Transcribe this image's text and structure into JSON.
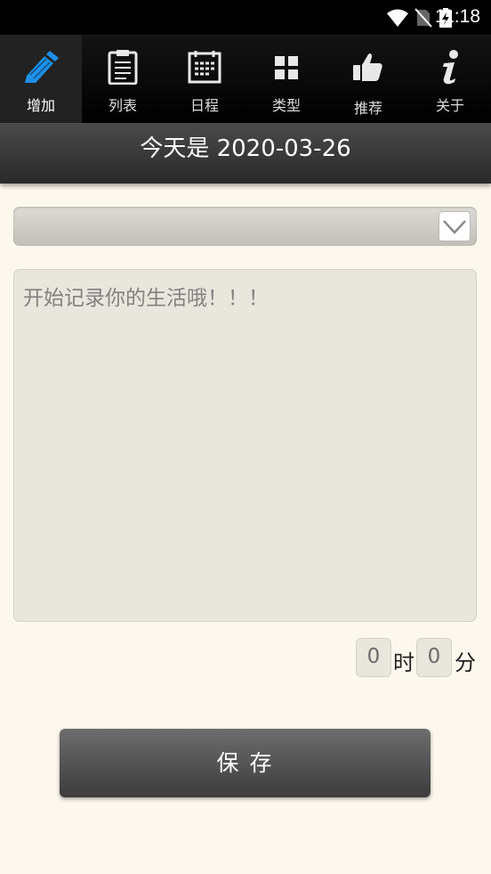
{
  "status_bar": {
    "time": "11:18"
  },
  "tabs": [
    {
      "label": "增加",
      "icon": "pencil-icon",
      "active": true
    },
    {
      "label": "列表",
      "icon": "clipboard-icon",
      "active": false
    },
    {
      "label": "日程",
      "icon": "calendar-icon",
      "active": false
    },
    {
      "label": "类型",
      "icon": "grid-icon",
      "active": false
    },
    {
      "label": "推荐",
      "icon": "thumbs-up-icon",
      "active": false
    },
    {
      "label": "关于",
      "icon": "info-icon",
      "active": false
    }
  ],
  "date_banner": {
    "text": "今天是 2020-03-26"
  },
  "category_select": {
    "value": ""
  },
  "diary_input": {
    "placeholder": "开始记录你的生活哦！！！",
    "value": ""
  },
  "duration": {
    "hours": "0",
    "hours_unit": "时",
    "minutes": "0",
    "minutes_unit": "分"
  },
  "save_button": {
    "label": "保 存"
  },
  "colors": {
    "accent": "#1e90e8",
    "background": "#fdf8ee",
    "tabbar": "#000000"
  }
}
